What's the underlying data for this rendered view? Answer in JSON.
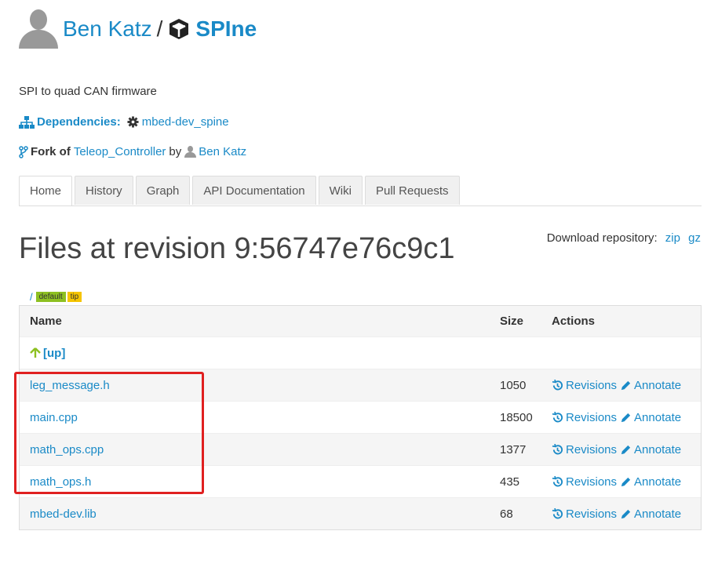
{
  "header": {
    "user": "Ben Katz",
    "separator": "/",
    "repo": "SPIne",
    "user_icon": "user-avatar-icon",
    "repo_icon": "cube-icon"
  },
  "description": "SPI to quad CAN firmware",
  "dependencies": {
    "label": "Dependencies:",
    "item": "mbed-dev_spine"
  },
  "fork": {
    "label": "Fork of",
    "repo": "Teleop_Controller",
    "by": "by",
    "author": "Ben Katz"
  },
  "tabs": [
    {
      "label": "Home",
      "active": true
    },
    {
      "label": "History"
    },
    {
      "label": "Graph"
    },
    {
      "label": "API Documentation"
    },
    {
      "label": "Wiki"
    },
    {
      "label": "Pull Requests"
    }
  ],
  "heading": "Files at revision 9:56747e76c9c1",
  "download": {
    "label": "Download repository:",
    "zip": "zip",
    "gz": "gz"
  },
  "breadcrumb": {
    "path": "/",
    "badges": [
      "default",
      "tip"
    ]
  },
  "table": {
    "columns": {
      "name": "Name",
      "size": "Size",
      "actions": "Actions"
    },
    "up_label": "[up]",
    "revisions_label": "Revisions",
    "annotate_label": "Annotate",
    "files": [
      {
        "name": "leg_message.h",
        "size": "1050"
      },
      {
        "name": "main.cpp",
        "size": "18500"
      },
      {
        "name": "math_ops.cpp",
        "size": "1377"
      },
      {
        "name": "math_ops.h",
        "size": "435"
      },
      {
        "name": "mbed-dev.lib",
        "size": "68"
      }
    ]
  },
  "colors": {
    "link": "#1a8ac7",
    "highlight": "#e02020",
    "default_badge": "#8dc021",
    "tip_badge": "#f5c400"
  }
}
